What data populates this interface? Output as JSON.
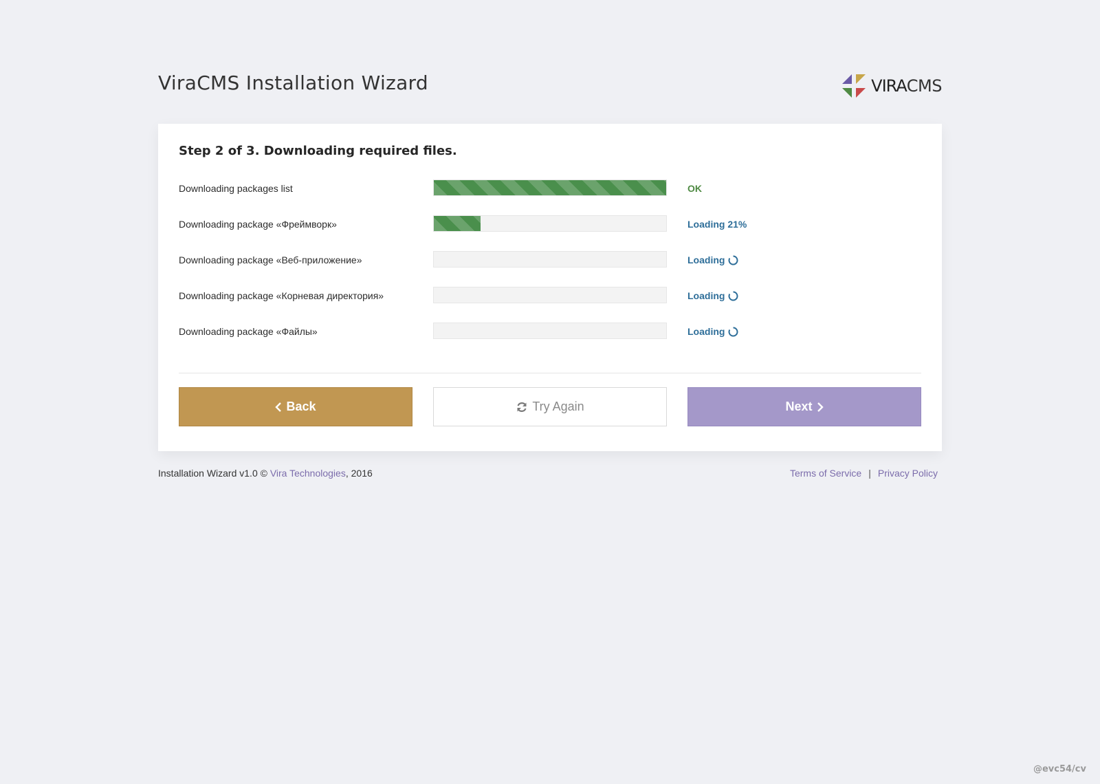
{
  "header": {
    "title": "ViraCMS Installation Wizard",
    "logo_text_bold": "VIRA",
    "logo_text_light": "CMS",
    "logo_colors": [
      "#6a5aa6",
      "#c7a64a",
      "#4f8a43",
      "#c94a4a"
    ]
  },
  "step": {
    "title": "Step 2 of 3. Downloading required files."
  },
  "tasks": [
    {
      "label": "Downloading packages list",
      "progress_percent": 100,
      "status": "OK",
      "state": "ok"
    },
    {
      "label": "Downloading package «Фреймворк»",
      "progress_percent": 20,
      "status": "Loading 21%",
      "state": "loading"
    },
    {
      "label": "Downloading package «Веб-приложение»",
      "progress_percent": 0,
      "status": "Loading",
      "state": "loading",
      "spinner": true
    },
    {
      "label": "Downloading package «Корневая директория»",
      "progress_percent": 0,
      "status": "Loading",
      "state": "loading",
      "spinner": true
    },
    {
      "label": "Downloading package «Файлы»",
      "progress_percent": 0,
      "status": "Loading",
      "state": "loading",
      "spinner": true
    }
  ],
  "buttons": {
    "back_label": "Back",
    "retry_label": "Try Again",
    "next_label": "Next",
    "back_icon": "chevron-left-icon",
    "retry_icon": "refresh-icon",
    "next_icon": "chevron-right-icon"
  },
  "footer": {
    "prefix": "Installation Wizard v1.0 © ",
    "company_link": "Vira Technologies",
    "suffix": ", 2016",
    "terms_link": "Terms of Service",
    "separator": "|",
    "privacy_link": "Privacy Policy"
  },
  "credit": "@evc54/cv",
  "colors": {
    "success": "#4f8a43",
    "loading": "#2e6e99",
    "back": "#c19752",
    "next": "#a498c9",
    "link": "#7b6cab"
  }
}
